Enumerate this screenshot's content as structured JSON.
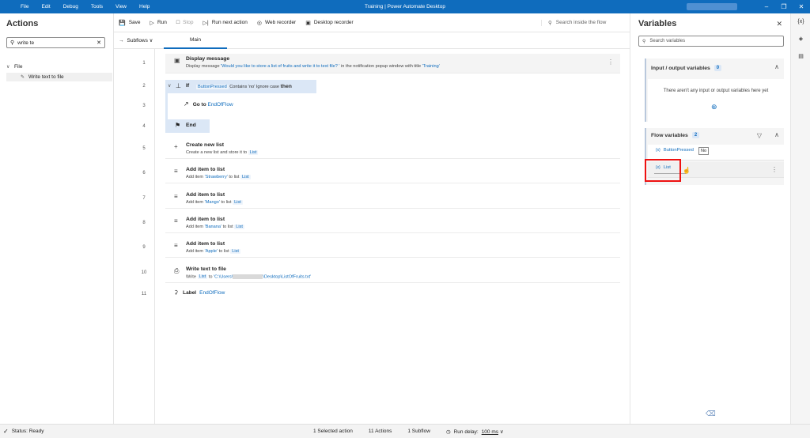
{
  "titlebar": {
    "menu": [
      "File",
      "Edit",
      "Debug",
      "Tools",
      "View",
      "Help"
    ],
    "title": "Training | Power Automate Desktop"
  },
  "actions": {
    "title": "Actions",
    "search_value": "write te",
    "tree": {
      "group": "File",
      "item": "Write text to file"
    }
  },
  "toolbar": {
    "save": "Save",
    "run": "Run",
    "stop": "Stop",
    "run_next": "Run next action",
    "web_recorder": "Web recorder",
    "desktop_recorder": "Desktop recorder",
    "search_placeholder": "Search inside the flow"
  },
  "subflows": {
    "label": "Subflows",
    "tab": "Main"
  },
  "line_numbers": [
    "1",
    "2",
    "3",
    "4",
    "5",
    "6",
    "7",
    "8",
    "9",
    "10",
    "11"
  ],
  "steps": {
    "s1": {
      "title": "Display message",
      "pre": "Display message ",
      "msg": "'Would you like to store a list of fruits and write it to text file? '",
      "mid": " in the notification popup window with title ",
      "ttl": "'Training'"
    },
    "s2": {
      "kw": "If",
      "var": "ButtonPressed",
      "cond": " Contains 'no' Ignore case ",
      "then": "then"
    },
    "s3": {
      "title": "Go to",
      "target": "EndOfFlow"
    },
    "s4": {
      "title": "End"
    },
    "s5": {
      "title": "Create new list",
      "pre": "Create a new list and store it to ",
      "var": "List"
    },
    "s6": {
      "title": "Add item to list",
      "pre": "Add item ",
      "item": "'Strawberry'",
      "mid": " to list ",
      "var": "List"
    },
    "s7": {
      "title": "Add item to list",
      "pre": "Add item ",
      "item": "'Mango'",
      "mid": " to list ",
      "var": "List"
    },
    "s8": {
      "title": "Add item to list",
      "pre": "Add item ",
      "item": "'Banana'",
      "mid": " to list ",
      "var": "List"
    },
    "s9": {
      "title": "Add item to list",
      "pre": "Add item ",
      "item": "'Apple'",
      "mid": " to list ",
      "var": "List"
    },
    "s10": {
      "title": "Write text to file",
      "pre": "Write ",
      "var": "List",
      "mid": " to ",
      "path1": "'C:\\Users\\",
      "path2": "\\Desktop\\ListOfFruits.txt'"
    },
    "s11": {
      "title": "Label",
      "name": "EndOfFlow"
    }
  },
  "variables": {
    "title": "Variables",
    "search_placeholder": "Search variables",
    "io": {
      "title": "Input / output variables",
      "count": "0",
      "empty": "There aren't any input or output variables here yet"
    },
    "flow": {
      "title": "Flow variables",
      "count": "2",
      "items": [
        "ButtonPressed",
        "List"
      ],
      "tooltip": "No"
    }
  },
  "status": {
    "state": "Status: Ready",
    "selected": "1 Selected action",
    "actions": "11 Actions",
    "subflow": "1 Subflow",
    "delay_label": "Run delay:",
    "delay_value": "100 ms"
  }
}
